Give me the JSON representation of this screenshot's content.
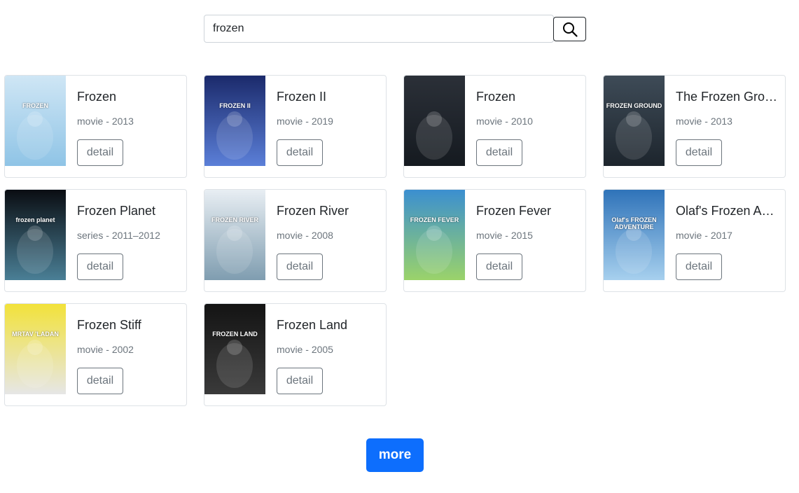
{
  "search": {
    "value": "frozen",
    "placeholder": "",
    "button_icon": "search-icon"
  },
  "results": [
    {
      "title": "Frozen",
      "type": "movie",
      "year": "2013",
      "detail_label": "detail",
      "poster_colors": [
        "#cfe6f5",
        "#8fc4e6"
      ],
      "poster_text": "FROZEN"
    },
    {
      "title": "Frozen II",
      "type": "movie",
      "year": "2019",
      "detail_label": "detail",
      "poster_colors": [
        "#1b2a6b",
        "#5b7fd8"
      ],
      "poster_text": "FROZEN II"
    },
    {
      "title": "Frozen",
      "type": "movie",
      "year": "2010",
      "detail_label": "detail",
      "poster_colors": [
        "#2b3038",
        "#151a20"
      ],
      "poster_text": ""
    },
    {
      "title": "The Frozen Ground",
      "type": "movie",
      "year": "2013",
      "detail_label": "detail",
      "poster_colors": [
        "#3e4b57",
        "#1d252d"
      ],
      "poster_text": "FROZEN GROUND"
    },
    {
      "title": "Frozen Planet",
      "type": "series",
      "year": "2011–2012",
      "detail_label": "detail",
      "poster_colors": [
        "#0a0d12",
        "#4a7f96"
      ],
      "poster_text": "frozen planet"
    },
    {
      "title": "Frozen River",
      "type": "movie",
      "year": "2008",
      "detail_label": "detail",
      "poster_colors": [
        "#e8eef3",
        "#7f9db0"
      ],
      "poster_text": "FROZEN RIVER"
    },
    {
      "title": "Frozen Fever",
      "type": "movie",
      "year": "2015",
      "detail_label": "detail",
      "poster_colors": [
        "#3b8fd0",
        "#9bd36a"
      ],
      "poster_text": "FROZEN FEVER"
    },
    {
      "title": "Olaf's Frozen Adventure",
      "type": "movie",
      "year": "2017",
      "detail_label": "detail",
      "poster_colors": [
        "#2f73b9",
        "#a7d0ee"
      ],
      "poster_text": "Olaf's FROZEN ADVENTURE"
    },
    {
      "title": "Frozen Stiff",
      "type": "movie",
      "year": "2002",
      "detail_label": "detail",
      "poster_colors": [
        "#f2e23a",
        "#e6e6e6"
      ],
      "poster_text": "MRTAV 'LADAN"
    },
    {
      "title": "Frozen Land",
      "type": "movie",
      "year": "2005",
      "detail_label": "detail",
      "poster_colors": [
        "#141414",
        "#3a3a3a"
      ],
      "poster_text": "FROZEN LAND"
    }
  ],
  "more_label": "more",
  "colors": {
    "primary": "#0d6efd",
    "secondary": "#6c757d",
    "border": "#dee2e6"
  }
}
